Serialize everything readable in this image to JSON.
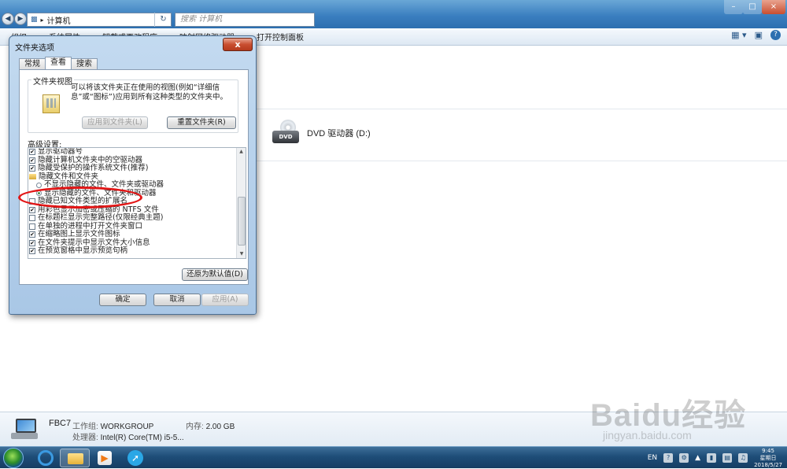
{
  "explorer": {
    "address": "计算机",
    "search_placeholder": "搜索 计算机",
    "toolbar": [
      "组织",
      "系统属性",
      "卸载或更改程序",
      "映射网络驱动器",
      "打开控制面板"
    ],
    "drive_label": "DVD 驱动器 (D:)",
    "drive_badge": "DVD",
    "details": {
      "name": "FBC7",
      "workgroup_key": "工作组:",
      "workgroup_val": "WORKGROUP",
      "memory_key": "内存:",
      "memory_val": "2.00 GB",
      "cpu_key": "处理器:",
      "cpu_val": "Intel(R) Core(TM) i5-5..."
    }
  },
  "dialog": {
    "title": "文件夹选项",
    "close": "x",
    "tabs": [
      "常规",
      "查看",
      "搜索"
    ],
    "active_tab": "查看",
    "folder_view": {
      "title": "文件夹视图",
      "description": "可以将该文件夹正在使用的视图(例如“详细信息”或“图标”)应用到所有这种类型的文件夹中。",
      "apply_button": "应用到文件夹(L)",
      "reset_button": "重置文件夹(R)"
    },
    "advanced_label": "高级设置:",
    "settings": [
      {
        "type": "checkbox",
        "checked": true,
        "label": "显示驱动器号"
      },
      {
        "type": "checkbox",
        "checked": true,
        "label": "隐藏计算机文件夹中的空驱动器"
      },
      {
        "type": "checkbox",
        "checked": true,
        "label": "隐藏受保护的操作系统文件(推荐)"
      },
      {
        "type": "folder",
        "label": "隐藏文件和文件夹"
      },
      {
        "type": "radio",
        "checked": false,
        "label": "不显示隐藏的文件、文件夹或驱动器"
      },
      {
        "type": "radio",
        "checked": true,
        "label": "显示隐藏的文件、文件夹和驱动器"
      },
      {
        "type": "checkbox",
        "checked": false,
        "label": "隐藏已知文件类型的扩展名"
      },
      {
        "type": "checkbox",
        "checked": true,
        "label": "用彩色显示加密或压缩的 NTFS 文件"
      },
      {
        "type": "checkbox",
        "checked": false,
        "label": "在标题栏显示完整路径(仅限经典主题)"
      },
      {
        "type": "checkbox",
        "checked": false,
        "label": "在单独的进程中打开文件夹窗口"
      },
      {
        "type": "checkbox",
        "checked": true,
        "label": "在缩略图上显示文件图标"
      },
      {
        "type": "checkbox",
        "checked": true,
        "label": "在文件夹提示中显示文件大小信息"
      },
      {
        "type": "checkbox",
        "checked": true,
        "label": "在预览窗格中显示预览句柄"
      }
    ],
    "restore_defaults": "还原为默认值(D)",
    "ok": "确定",
    "cancel": "取消",
    "apply": "应用(A)"
  },
  "taskbar": {
    "tray_lang": "EN",
    "tray_help": "?",
    "clock_time": "9:45",
    "clock_day": "星期日",
    "clock_date": "2018/5/27"
  },
  "watermark": {
    "main": "Baidu经验",
    "sub": "jingyan.baidu.com"
  },
  "colors": {
    "taskbar": "#1e4d78",
    "dialog_frame": "#a9c7e6",
    "highlight_ellipse": "#e21616"
  }
}
